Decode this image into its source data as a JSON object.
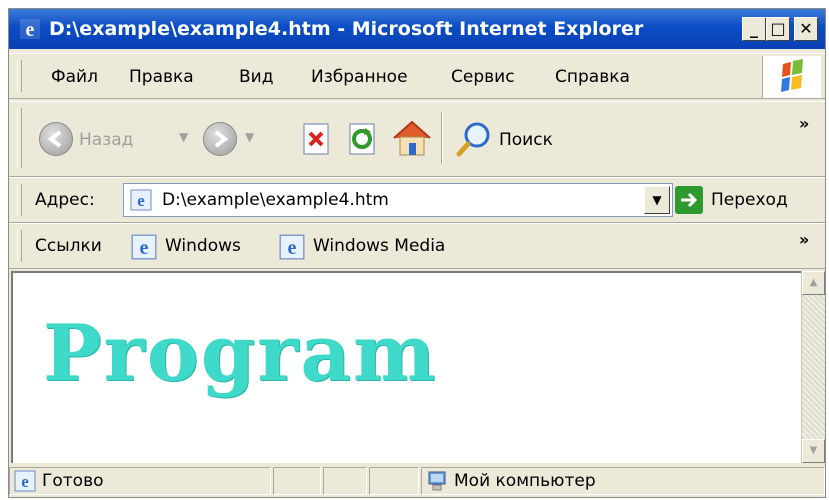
{
  "window": {
    "title": "D:\\example\\example4.htm - Microsoft Internet Explorer",
    "controls": {
      "minimize": "_",
      "maximize": "□",
      "close": "✕"
    }
  },
  "menu": {
    "items": [
      {
        "label": "Файл"
      },
      {
        "label": "Правка"
      },
      {
        "label": "Вид"
      },
      {
        "label": "Избранное"
      },
      {
        "label": "Сервис"
      },
      {
        "label": "Справка"
      }
    ]
  },
  "toolbar": {
    "back_label": "Назад",
    "search_label": "Поиск",
    "more": "»"
  },
  "address": {
    "label": "Адрес:",
    "value": "D:\\example\\example4.htm",
    "go_label": "Переход"
  },
  "links": {
    "label": "Ссылки",
    "items": [
      {
        "label": "Windows"
      },
      {
        "label": "Windows Media"
      }
    ],
    "more": "»"
  },
  "page": {
    "heading": "Program",
    "heading_color": "#3ed9c8"
  },
  "status": {
    "text": "Готово",
    "zone": "Мой компьютер"
  },
  "colors": {
    "titlebar": "#0a4dc4",
    "chrome": "#ece9d8"
  }
}
